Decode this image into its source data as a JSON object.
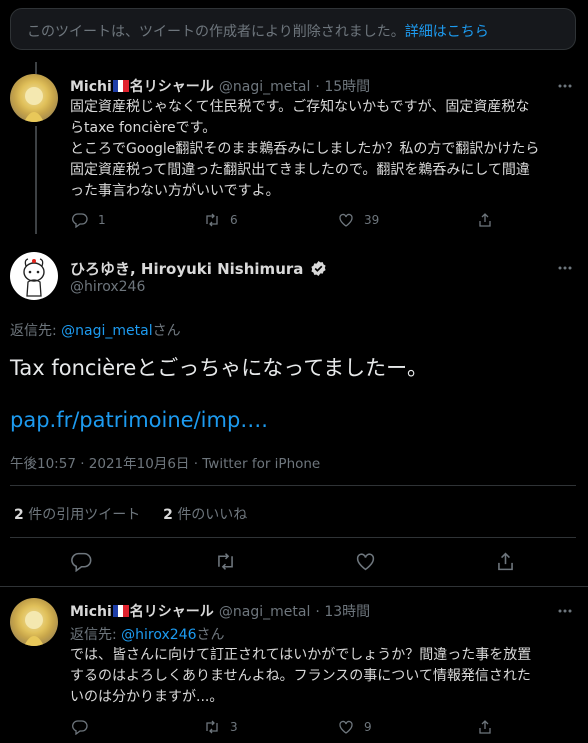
{
  "deleted_notice": {
    "text": "このツイートは、ツイートの作成者により削除されました。",
    "link": "詳細はこちら"
  },
  "tweet1": {
    "name_before_flag": "Michi",
    "name_after_flag": "名リシャール",
    "handle": "@nagi_metal",
    "time": "· 15時間",
    "lines": [
      "固定資産税じゃなくて住民税です。ご存知ないかもですが、固定資産税な",
      "らtaxe foncièreです。",
      "ところでGoogle翻訳そのまま鵜呑みにしましたか？私の方で翻訳かけたら",
      "固定資産税って間違った翻訳出てきましたので。翻訳を鵜呑みにして間違",
      "った事言わない方がいいですよ。"
    ],
    "replies": "1",
    "retweets": "6",
    "likes": "39"
  },
  "main_tweet": {
    "name": "ひろゆき, Hiroyuki Nishimura",
    "handle": "@hirox246",
    "reply_label": "返信先:",
    "reply_handle": "@nagi_metal",
    "reply_suffix": "さん",
    "text": "Tax foncièreとごっちゃになってましたー。",
    "link": "pap.fr/patrimoine/imp….",
    "meta_time": "午後10:57 · 2021年10月6日 · ",
    "meta_client": "Twitter for iPhone",
    "quote_count": "2",
    "quote_label": "件の引用ツイート",
    "like_count": "2",
    "like_label": "件のいいね"
  },
  "tweet3": {
    "name_before_flag": "Michi",
    "name_after_flag": "名リシャール",
    "handle": "@nagi_metal",
    "time": "· 13時間",
    "reply_label": "返信先:",
    "reply_handle": "@hirox246",
    "reply_suffix": "さん",
    "lines": [
      "では、皆さんに向けて訂正されてはいかがでしょうか？間違った事を放置",
      "するのはよろしくありませんよね。フランスの事について情報発信された",
      "いのは分かりますが...。"
    ],
    "retweets": "3",
    "likes": "9"
  },
  "colors": {
    "background": "#000000",
    "text": "#d9d9d9",
    "muted": "#6e767d",
    "link": "#1d9bf0",
    "divider": "#2f3336",
    "verified": "#d9d9d9"
  },
  "icons": [
    "reply-icon",
    "retweet-icon",
    "like-icon",
    "share-icon",
    "more-icon",
    "verified-badge-icon",
    "france-flag-icon"
  ]
}
